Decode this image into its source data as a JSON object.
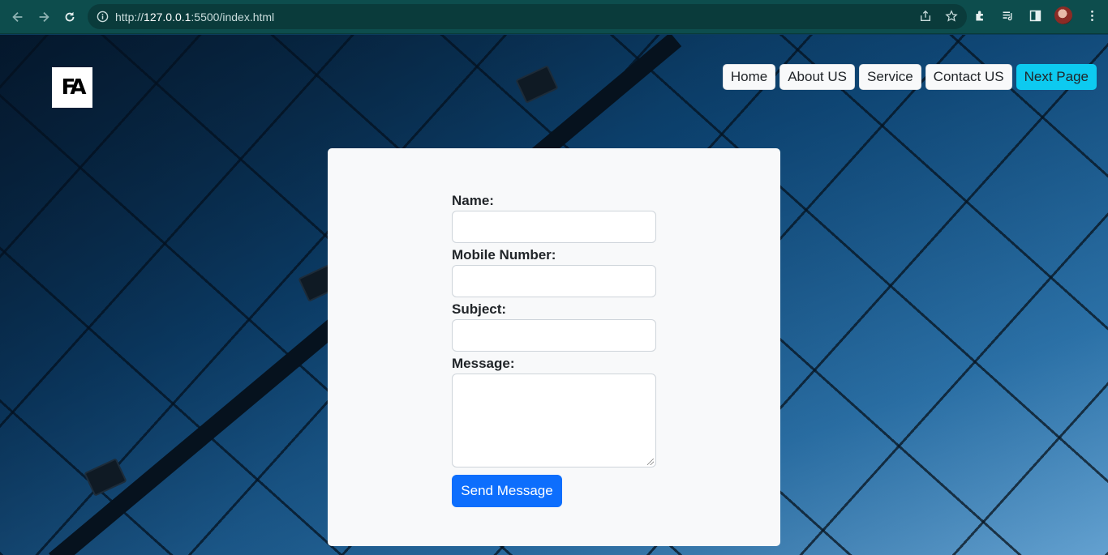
{
  "browser": {
    "url_scheme": "http://",
    "url_host": "127.0.0.1",
    "url_rest": ":5500/index.html"
  },
  "logo": {
    "text": "FA"
  },
  "nav": {
    "items": [
      {
        "label": "Home"
      },
      {
        "label": "About US"
      },
      {
        "label": "Service"
      },
      {
        "label": "Contact US"
      },
      {
        "label": "Next Page"
      }
    ],
    "accent_color": "#0dcaf0"
  },
  "form": {
    "name_label": "Name:",
    "name_value": "",
    "mobile_label": "Mobile Number:",
    "mobile_value": "",
    "subject_label": "Subject:",
    "subject_value": "",
    "message_label": "Message:",
    "message_value": "",
    "submit_label": "Send Message",
    "submit_color": "#0d6efd"
  }
}
